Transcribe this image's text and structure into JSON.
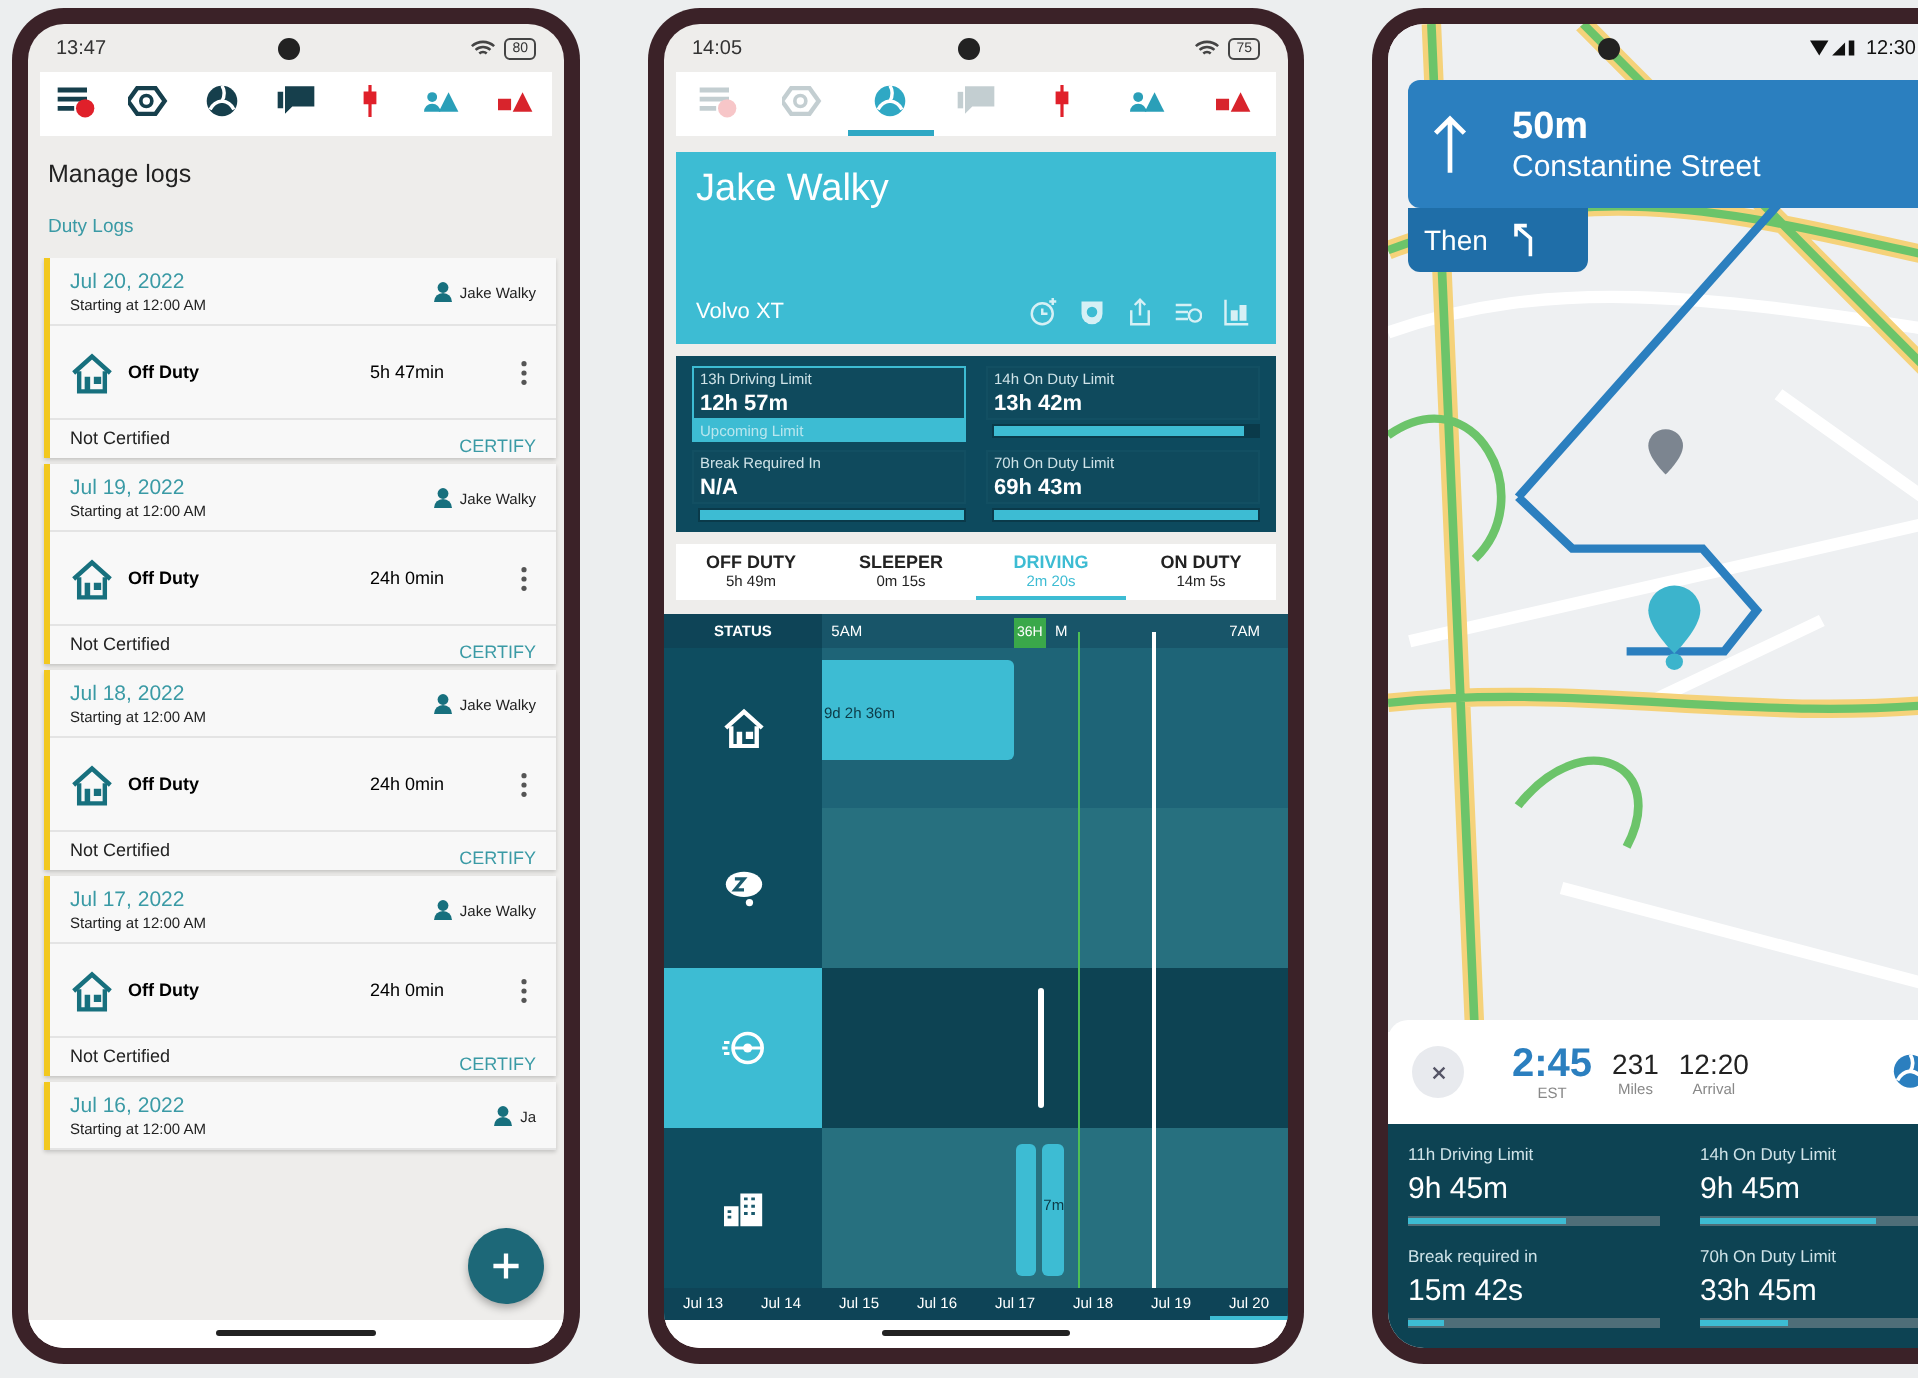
{
  "log_screen": {
    "status_bar": {
      "time": "13:47",
      "battery": "80"
    },
    "toolbar": [
      {
        "kind": "menu",
        "selected": false,
        "disabled": false
      },
      {
        "kind": "nut",
        "selected": false,
        "disabled": false
      },
      {
        "kind": "logo",
        "selected": false,
        "disabled": false
      },
      {
        "kind": "chat",
        "selected": false,
        "disabled": false
      },
      {
        "kind": "connector",
        "selected": false,
        "disabled": false
      },
      {
        "kind": "driver-alert",
        "selected": false,
        "disabled": false
      },
      {
        "kind": "truck-alert",
        "selected": false,
        "disabled": false
      }
    ],
    "title": "Manage logs",
    "section": "Duty Logs",
    "logs": [
      {
        "date": "Jul 20, 2022",
        "start": "Starting at 12:00 AM",
        "driver": "Jake Walky",
        "status": "Off Duty",
        "duration": "5h 47min",
        "certification": "Not Certified",
        "action": "CERTIFY"
      },
      {
        "date": "Jul 19, 2022",
        "start": "Starting at 12:00 AM",
        "driver": "Jake Walky",
        "status": "Off Duty",
        "duration": "24h 0min",
        "certification": "Not Certified",
        "action": "CERTIFY"
      },
      {
        "date": "Jul 18, 2022",
        "start": "Starting at 12:00 AM",
        "driver": "Jake Walky",
        "status": "Off Duty",
        "duration": "24h 0min",
        "certification": "Not Certified",
        "action": "CERTIFY"
      },
      {
        "date": "Jul 17, 2022",
        "start": "Starting at 12:00 AM",
        "driver": "Jake Walky",
        "status": "Off Duty",
        "duration": "24h 0min",
        "certification": "Not Certified",
        "action": "CERTIFY"
      },
      {
        "date": "Jul 16, 2022",
        "start": "Starting at 12:00 AM",
        "driver": "Ja"
      }
    ]
  },
  "driver_screen": {
    "status_bar": {
      "time": "14:05",
      "battery": "75"
    },
    "toolbar": [
      {
        "kind": "menu",
        "selected": false,
        "disabled": true
      },
      {
        "kind": "nut",
        "selected": false,
        "disabled": true
      },
      {
        "kind": "logo",
        "selected": true,
        "disabled": false
      },
      {
        "kind": "chat",
        "selected": false,
        "disabled": true
      },
      {
        "kind": "connector",
        "selected": false,
        "disabled": false
      },
      {
        "kind": "driver-alert",
        "selected": false,
        "disabled": false
      },
      {
        "kind": "truck-alert",
        "selected": false,
        "disabled": false
      }
    ],
    "driver": "Jake Walky",
    "vehicle": "Volvo XT",
    "actions": [
      {
        "kind": "clock-add"
      },
      {
        "kind": "shield"
      },
      {
        "kind": "share"
      },
      {
        "kind": "list"
      },
      {
        "kind": "cargo"
      }
    ],
    "limits": [
      {
        "label": "13h Driving Limit",
        "value": "12h 57m",
        "note": "Upcoming Limit",
        "selected": true
      },
      {
        "label": "14h On Duty Limit",
        "value": "13h 42m",
        "level": 0.95,
        "selected": false
      },
      {
        "label": "Break Required In",
        "value": "N/A",
        "level": 1,
        "selected": false
      },
      {
        "label": "70h On Duty Limit",
        "value": "69h 43m",
        "level": 1,
        "selected": false
      }
    ],
    "duty_tabs": [
      {
        "label": "OFF DUTY",
        "time": "5h 49m",
        "selected": false
      },
      {
        "label": "SLEEPER",
        "time": "0m 15s",
        "selected": false
      },
      {
        "label": "DRIVING",
        "time": "2m 20s",
        "selected": true
      },
      {
        "label": "ON DUTY",
        "time": "14m 5s",
        "selected": false
      }
    ],
    "timeline": {
      "header": "STATUS",
      "hours": [
        "5AM",
        "M",
        "7AM"
      ],
      "marker": "36H",
      "rows": [
        {
          "kind": "off-duty",
          "selected": false,
          "bar_label": "9d 2h 36m"
        },
        {
          "kind": "sleeper",
          "selected": false
        },
        {
          "kind": "driving",
          "selected": true
        },
        {
          "kind": "on-duty",
          "selected": false,
          "bar_label": "7m"
        }
      ],
      "dates": [
        {
          "label": "Jul 13",
          "selected": false
        },
        {
          "label": "Jul 14",
          "selected": false
        },
        {
          "label": "Jul 15",
          "selected": false
        },
        {
          "label": "Jul 16",
          "selected": false
        },
        {
          "label": "Jul 17",
          "selected": false
        },
        {
          "label": "Jul 18",
          "selected": false
        },
        {
          "label": "Jul 19",
          "selected": false
        },
        {
          "label": "Jul 20",
          "selected": true
        }
      ]
    }
  },
  "navigation_screen": {
    "status_bar": {
      "time": "12:30"
    },
    "instruction": {
      "distance": "50m",
      "street": "Constantine Street",
      "then": "Then"
    },
    "trip": {
      "duration": "2:45",
      "zone": "EST",
      "miles": "231",
      "miles_label": "Miles",
      "arrival": "12:20",
      "arrival_label": "Arrival"
    },
    "limits": [
      {
        "label": "11h Driving Limit",
        "value": "9h 45m",
        "level": 0.63
      },
      {
        "label": "14h On Duty Limit",
        "value": "9h 45m",
        "level": 0.7
      },
      {
        "label": "Break required in",
        "value": "15m 42s",
        "level": 0.14
      },
      {
        "label": "70h On Duty Limit",
        "value": "33h 45m",
        "level": 0.35
      }
    ]
  }
}
